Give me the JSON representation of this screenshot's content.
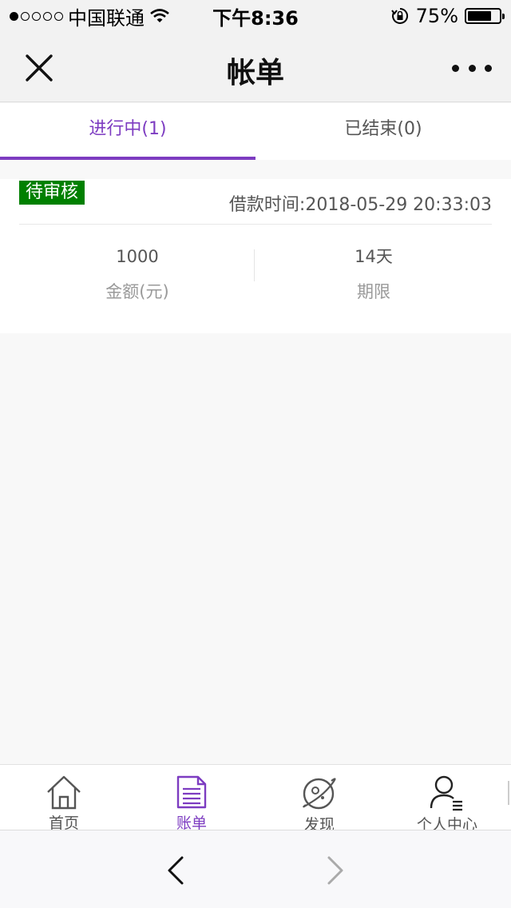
{
  "status_bar": {
    "carrier": "中国联通",
    "time": "下午8:36",
    "battery": "75%",
    "battery_level": 0.75
  },
  "title_bar": {
    "title": "帐单",
    "close_icon": "close-icon",
    "more_icon": "more-icon"
  },
  "tabs": [
    {
      "label": "进行中(1)",
      "active": true
    },
    {
      "label": "已结束(0)",
      "active": false
    }
  ],
  "bill": {
    "status": "待审核",
    "status_color": "#008000",
    "loan_time": "借款时间:2018-05-29 20:33:03",
    "amount_value": "1000",
    "amount_label": "金额(元)",
    "term_value": "14天",
    "term_label": "期限"
  },
  "tab_bar": {
    "items": [
      {
        "label": "首页",
        "icon": "home-icon",
        "active": false
      },
      {
        "label": "账单",
        "icon": "bill-icon",
        "active": true
      },
      {
        "label": "发现",
        "icon": "planet-icon",
        "active": false
      },
      {
        "label": "个人中心",
        "icon": "user-icon",
        "active": false
      }
    ]
  },
  "browser_bar": {
    "back_icon": "chevron-left-icon",
    "forward_icon": "chevron-right-icon"
  },
  "colors": {
    "accent": "#7d3cc1",
    "status_green": "#008000"
  }
}
